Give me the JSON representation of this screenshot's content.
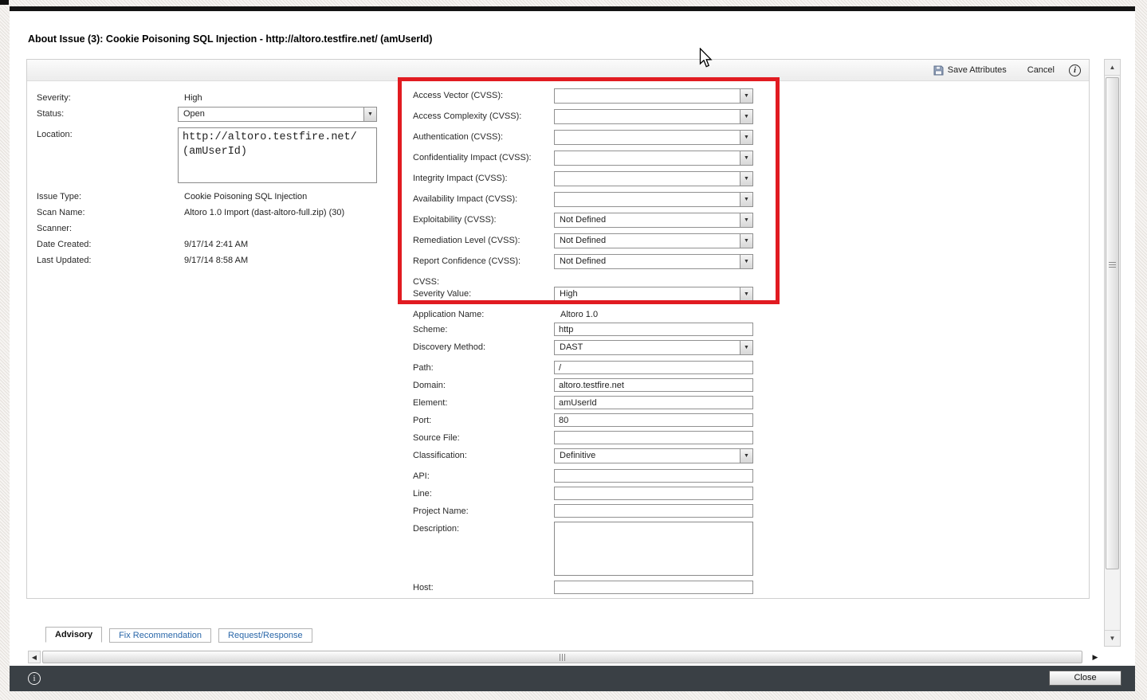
{
  "window": {
    "title": "About Issue (3): Cookie Poisoning SQL Injection - http://altoro.testfire.net/ (amUserId)"
  },
  "toolbar": {
    "save_label": "Save Attributes",
    "cancel_label": "Cancel",
    "save_icon": "floppy-disk-icon",
    "info_icon": "info-icon"
  },
  "colors": {
    "highlight_box": "#e11b21",
    "footer_bar": "#3a4045",
    "tab_link": "#2a67a9"
  },
  "form": {
    "left_rows": [
      {
        "label": "Severity:",
        "value": "High",
        "type": "static"
      },
      {
        "label": "Status:",
        "value": "Open",
        "type": "select"
      },
      {
        "label": "Location:",
        "value": "http://altoro.testfire.net/\n(amUserId)",
        "type": "textarea",
        "mono": true,
        "height": 70
      },
      {
        "label": "Issue Type:",
        "value": "Cookie Poisoning SQL Injection",
        "type": "static"
      },
      {
        "label": "Scan Name:",
        "value": "Altoro 1.0 Import (dast-altoro-full.zip) (30)",
        "type": "static"
      },
      {
        "label": "Scanner:",
        "value": "",
        "type": "static"
      },
      {
        "label": "Date Created:",
        "value": "9/17/14 2:41 AM",
        "type": "static"
      },
      {
        "label": "Last Updated:",
        "value": "9/17/14 8:58 AM",
        "type": "static"
      }
    ],
    "right_rows": [
      {
        "label": "Access Vector (CVSS):",
        "value": "",
        "type": "select"
      },
      {
        "label": "Access Complexity (CVSS):",
        "value": "",
        "type": "select"
      },
      {
        "label": "Authentication (CVSS):",
        "value": "",
        "type": "select"
      },
      {
        "label": "Confidentiality Impact (CVSS):",
        "value": "",
        "type": "select"
      },
      {
        "label": "Integrity Impact (CVSS):",
        "value": "",
        "type": "select"
      },
      {
        "label": "Availability Impact (CVSS):",
        "value": "",
        "type": "select"
      },
      {
        "label": "Exploitability (CVSS):",
        "value": "Not Defined",
        "type": "select"
      },
      {
        "label": "Remediation Level (CVSS):",
        "value": "Not Defined",
        "type": "select"
      },
      {
        "label": "Report Confidence (CVSS):",
        "value": "Not Defined",
        "type": "select"
      },
      {
        "label": "CVSS:",
        "value": "",
        "type": "labelonly"
      },
      {
        "label": "Severity Value:",
        "value": "High",
        "type": "select"
      },
      {
        "label": "Application Name:",
        "value": "Altoro 1.0",
        "type": "static"
      },
      {
        "label": "Scheme:",
        "value": "http",
        "type": "text"
      },
      {
        "label": "Discovery Method:",
        "value": "DAST",
        "type": "select"
      },
      {
        "label": "Path:",
        "value": "/",
        "type": "text"
      },
      {
        "label": "Domain:",
        "value": "altoro.testfire.net",
        "type": "text"
      },
      {
        "label": "Element:",
        "value": "amUserId",
        "type": "text"
      },
      {
        "label": "Port:",
        "value": "80",
        "type": "text"
      },
      {
        "label": "Source File:",
        "value": "",
        "type": "text"
      },
      {
        "label": "Classification:",
        "value": "Definitive",
        "type": "select"
      },
      {
        "label": "API:",
        "value": "",
        "type": "text"
      },
      {
        "label": "Line:",
        "value": "",
        "type": "text"
      },
      {
        "label": "Project Name:",
        "value": "",
        "type": "text"
      },
      {
        "label": "Description:",
        "value": "",
        "type": "textarea",
        "mono": false,
        "height": 68
      },
      {
        "label": "Host:",
        "value": "",
        "type": "text"
      }
    ]
  },
  "tabs": [
    {
      "label": "Advisory"
    },
    {
      "label": "Fix Recommendation"
    },
    {
      "label": "Request/Response"
    }
  ],
  "scrollbars": {
    "vertical_grip": "grip-dots-icon",
    "horizontal_grip": "grip-dots-icon",
    "up_arrow": "chevron-up-icon",
    "down_arrow": "chevron-down-icon",
    "left_arrow": "chevron-left-icon",
    "right_arrow": "chevron-right-icon"
  },
  "footer": {
    "close_label": "Close",
    "info_icon": "info-icon"
  }
}
